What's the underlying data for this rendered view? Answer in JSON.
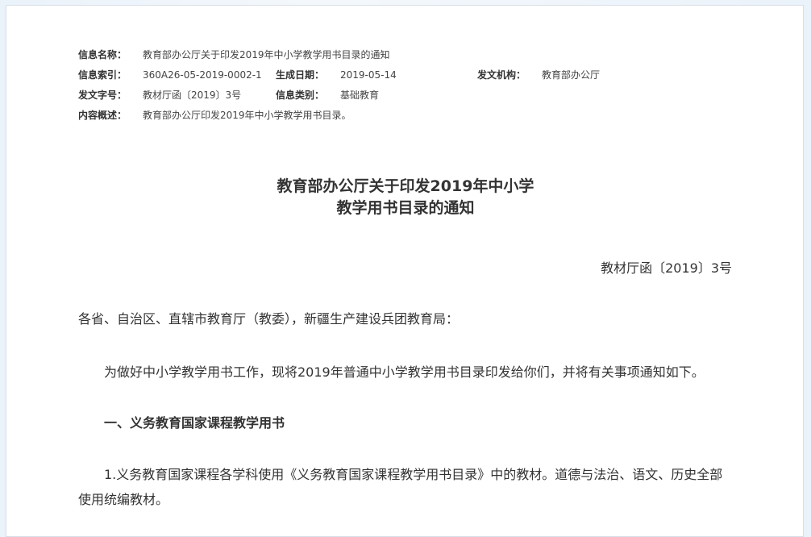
{
  "meta": {
    "name_label": "信息名称：",
    "name_value": "教育部办公厅关于印发2019年中小学教学用书目录的通知",
    "index_label": "信息索引：",
    "index_value": "360A26-05-2019-0002-1",
    "date_label": "生成日期：",
    "date_value": "2019-05-14",
    "issuer_label": "发文机构：",
    "issuer_value": "教育部办公厅",
    "docno_label": "发文字号：",
    "docno_value": "教材厅函〔2019〕3号",
    "category_label": "信息类别：",
    "category_value": "基础教育",
    "summary_label": "内容概述：",
    "summary_value": "教育部办公厅印发2019年中小学教学用书目录。"
  },
  "document": {
    "title_line1": "教育部办公厅关于印发2019年中小学",
    "title_line2": "教学用书目录的通知",
    "doc_number": "教材厅函〔2019〕3号",
    "salutation": "各省、自治区、直辖市教育厅（教委），新疆生产建设兵团教育局：",
    "intro": "为做好中小学教学用书工作，现将2019年普通中小学教学用书目录印发给你们，并将有关事项通知如下。",
    "section1_heading": "一、义务教育国家课程教学用书",
    "item1_line1": "1.义务教育国家课程各学科使用《义务教育国家课程教学用书目录》中的教材。道德与法治、语文、历史全部",
    "item1_line2": "使用统编教材。"
  }
}
